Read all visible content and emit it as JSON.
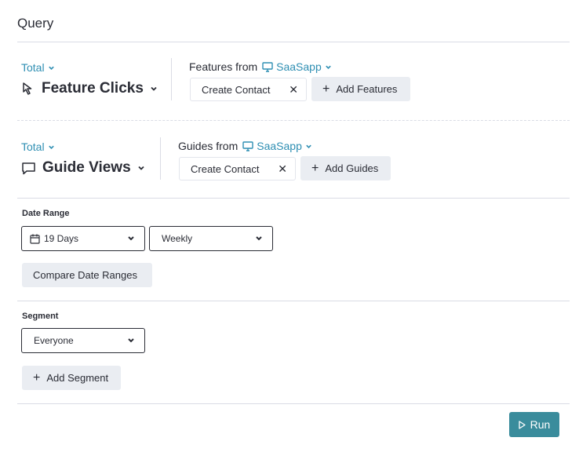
{
  "query": {
    "title": "Query"
  },
  "features_row": {
    "aggregation": "Total",
    "metric": "Feature Clicks",
    "from_label": "Features from",
    "app_name": "SaaSapp",
    "chip": "Create Contact",
    "add_label": "Add Features"
  },
  "guides_row": {
    "aggregation": "Total",
    "metric": "Guide Views",
    "from_label": "Guides from",
    "app_name": "SaaSapp",
    "chip": "Create Contact",
    "add_label": "Add Guides"
  },
  "date_range": {
    "label": "Date Range",
    "range_value": "19 Days",
    "interval_value": "Weekly",
    "compare_label": "Compare Date Ranges"
  },
  "segment": {
    "label": "Segment",
    "value": "Everyone",
    "add_label": "Add Segment"
  },
  "run": {
    "label": "Run"
  },
  "colors": {
    "accent": "#2f8fb3",
    "run_button": "#3a8c9c",
    "divider": "#dadce5",
    "button_gray": "#eaedf2"
  },
  "icons": [
    "cursor-arrow-icon",
    "chat-bubble-icon",
    "monitor-icon",
    "calendar-icon",
    "chevron-down-icon",
    "close-icon",
    "plus-icon",
    "play-icon"
  ]
}
